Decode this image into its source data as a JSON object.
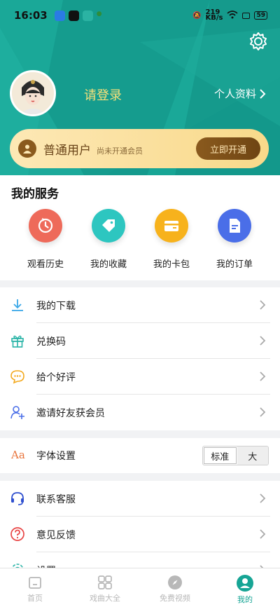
{
  "status_bar": {
    "time": "16:03",
    "network_speed": "219\nKB/s",
    "battery": "59"
  },
  "header": {
    "login_text": "请登录",
    "profile_link": "个人资料",
    "icons": [
      "settings-icon",
      "avatar-illustration"
    ]
  },
  "membership": {
    "title": "普通用户",
    "subtitle": "尚未开通会员",
    "button": "立即开通"
  },
  "services": {
    "title": "我的服务",
    "items": [
      {
        "label": "观看历史",
        "icon": "history-icon",
        "color": "#ee6a5a"
      },
      {
        "label": "我的收藏",
        "icon": "tag-icon",
        "color": "#2dc6c0"
      },
      {
        "label": "我的卡包",
        "icon": "wallet-icon",
        "color": "#f7b21c"
      },
      {
        "label": "我的订单",
        "icon": "order-icon",
        "color": "#4a6ee8"
      }
    ]
  },
  "menu_group_1": [
    {
      "label": "我的下载",
      "icon": "download-icon"
    },
    {
      "label": "兑换码",
      "icon": "gift-icon"
    },
    {
      "label": "给个好评",
      "icon": "comment-icon"
    },
    {
      "label": "邀请好友获会员",
      "icon": "invite-user-icon"
    }
  ],
  "font_setting": {
    "label": "字体设置",
    "icon_text": "Aa",
    "options": [
      "标准",
      "大"
    ],
    "selected": "标准"
  },
  "menu_group_2": [
    {
      "label": "联系客服",
      "icon": "headset-icon"
    },
    {
      "label": "意见反馈",
      "icon": "question-icon"
    },
    {
      "label": "设置",
      "icon": "settings-icon"
    }
  ],
  "bottom_nav": [
    {
      "label": "首页",
      "icon": "home-icon",
      "active": false
    },
    {
      "label": "戏曲大全",
      "icon": "grid-icon",
      "active": false
    },
    {
      "label": "免费视频",
      "icon": "compass-icon",
      "active": false
    },
    {
      "label": "我的",
      "icon": "user-icon",
      "active": true
    }
  ],
  "colors": {
    "header_teal": "#17a595",
    "login_yellow": "#f7e07a",
    "member_gold": "#f8d98a",
    "button_brown": "#7a4d18"
  }
}
